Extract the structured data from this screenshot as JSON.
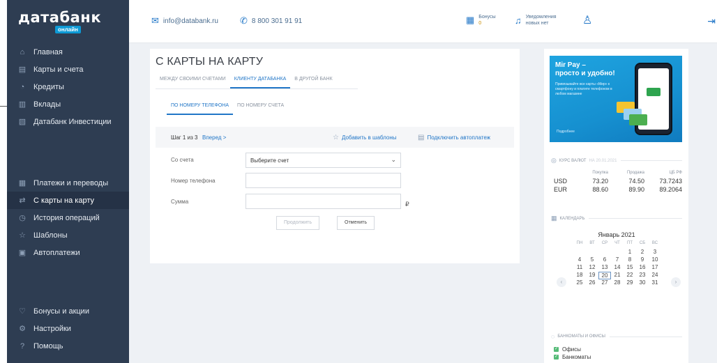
{
  "app": {
    "logo_text": "датабанк",
    "logo_badge": "онлайн"
  },
  "sidebar": {
    "items_top": [
      {
        "label": "Главная",
        "icon": "home-icon"
      },
      {
        "label": "Карты и счета",
        "icon": "cards-icon"
      },
      {
        "label": "Кредиты",
        "icon": "credit-icon"
      },
      {
        "label": "Вклады",
        "icon": "deposit-icon"
      },
      {
        "label": "Датабанк Инвестиции",
        "icon": "invest-icon"
      }
    ],
    "items_mid": [
      {
        "label": "Платежи и переводы",
        "icon": "payments-icon"
      },
      {
        "label": "С карты на карту",
        "icon": "card-transfer-icon",
        "active": true
      },
      {
        "label": "История операций",
        "icon": "history-icon"
      },
      {
        "label": "Шаблоны",
        "icon": "star-icon"
      },
      {
        "label": "Автоплатежи",
        "icon": "autopay-icon"
      }
    ],
    "items_bottom": [
      {
        "label": "Бонусы и акции",
        "icon": "bonus-icon"
      },
      {
        "label": "Настройки",
        "icon": "settings-icon"
      },
      {
        "label": "Помощь",
        "icon": "help-icon"
      }
    ]
  },
  "header": {
    "email": "info@databank.ru",
    "phone": "8 800 301 91 91",
    "bonus_label": "Бонусы",
    "bonus_value": "0",
    "notif_label": "Уведомления",
    "notif_value": "новых нет"
  },
  "transfer": {
    "title": "С КАРТЫ НА КАРТУ",
    "tabs": [
      "МЕЖДУ СВОИМИ СЧЕТАМИ",
      "КЛИЕНТУ ДАТАБАНКА",
      "В ДРУГОЙ БАНК"
    ],
    "active_tab": 1,
    "subtabs": [
      "ПО НОМЕРУ ТЕЛЕФОНА",
      "ПО НОМЕРУ СЧЕТА"
    ],
    "active_subtab": 0,
    "step_label": "Шаг 1 из 3",
    "step_next": "Вперед >",
    "add_template": "Добавить в шаблоны",
    "connect_autopay": "Подключить автоплатеж",
    "from_label": "Со счета",
    "from_value": "Выберите счет",
    "phone_label": "Номер телефона",
    "phone_value": "",
    "amount_label": "Сумма",
    "amount_value": "",
    "currency_symbol": "₽",
    "continue_btn": "Продолжить",
    "cancel_btn": "Отменить"
  },
  "promo": {
    "title_line1": "Mir Pay –",
    "title_line2": "просто и удобно!",
    "text": "Привязывайте все карты «Мир» к смартфону и платите телефоном в любом магазине",
    "small": "Подробнее"
  },
  "rates": {
    "heading": "КУРС ВАЛЮТ",
    "date": "на 20.01.2021",
    "col_buy": "Покупка",
    "col_sell": "Продажа",
    "col_cb": "ЦБ РФ",
    "rows": [
      {
        "cur": "USD",
        "buy": "73.20",
        "sell": "74.50",
        "cb": "73.7243"
      },
      {
        "cur": "EUR",
        "buy": "88.60",
        "sell": "89.90",
        "cb": "89.2064"
      }
    ]
  },
  "calendar": {
    "heading": "КАЛЕНДАРЬ",
    "month": "Январь 2021",
    "dow": [
      "ПН",
      "ВТ",
      "СР",
      "ЧТ",
      "ПТ",
      "СБ",
      "ВС"
    ],
    "weeks": [
      [
        "",
        "",
        "",
        "",
        "1",
        "2",
        "3"
      ],
      [
        "4",
        "5",
        "6",
        "7",
        "8",
        "9",
        "10"
      ],
      [
        "11",
        "12",
        "13",
        "14",
        "15",
        "16",
        "17"
      ],
      [
        "18",
        "19",
        "20",
        "21",
        "22",
        "23",
        "24"
      ],
      [
        "25",
        "26",
        "27",
        "28",
        "29",
        "30",
        "31"
      ]
    ],
    "today": "20"
  },
  "atm": {
    "heading": "БАНКОМАТЫ И ОФИСЫ",
    "options": [
      "Офисы",
      "Банкоматы"
    ]
  },
  "colors": {
    "sidebar": "#2e3d52",
    "accent": "#2176c7",
    "content_bg": "#eef1f5"
  }
}
